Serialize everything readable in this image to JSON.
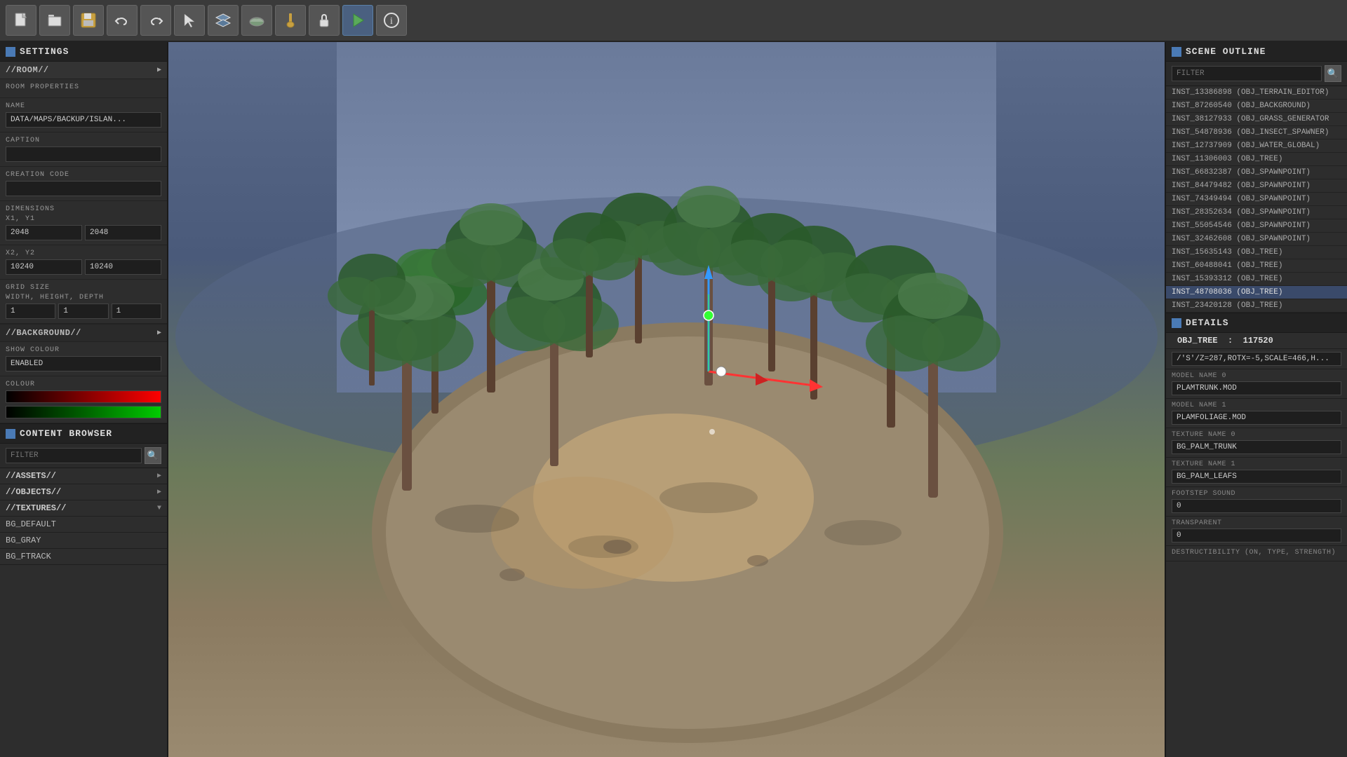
{
  "toolbar": {
    "title": "SETTINGS",
    "tools": [
      {
        "id": "new",
        "icon": "📄",
        "label": "new-file"
      },
      {
        "id": "open",
        "icon": "🗂",
        "label": "open-file"
      },
      {
        "id": "save",
        "icon": "📁",
        "label": "save-file"
      },
      {
        "id": "undo5",
        "icon": "↺",
        "label": "undo"
      },
      {
        "id": "redo",
        "icon": "↻",
        "label": "redo"
      },
      {
        "id": "select",
        "icon": "🖱",
        "label": "select"
      },
      {
        "id": "layer",
        "icon": "⬡",
        "label": "layer"
      },
      {
        "id": "terrain",
        "icon": "⛰",
        "label": "terrain"
      },
      {
        "id": "paint",
        "icon": "🖌",
        "label": "paint"
      },
      {
        "id": "lock",
        "icon": "🔒",
        "label": "lock"
      },
      {
        "id": "play",
        "icon": "▶",
        "label": "play"
      },
      {
        "id": "info",
        "icon": "ℹ",
        "label": "info"
      }
    ]
  },
  "left_panel": {
    "title": "SETTINGS",
    "room_section": {
      "label": "//ROOM//",
      "subsection_label": "ROOM PROPERTIES",
      "name_label": "NAME",
      "name_value": "DATA/MAPS/BACKUP/ISLAN...",
      "caption_label": "CAPTION",
      "caption_value": "",
      "creation_code_label": "CREATION CODE",
      "creation_code_value": "",
      "dimensions_label": "DIMENSIONS",
      "x1y1_label": "X1, Y1",
      "x1_value": "2048",
      "y1_value": "2048",
      "x2y2_label": "X2, Y2",
      "x2_value": "10240",
      "y2_value": "10240",
      "grid_size_label": "GRID SIZE",
      "whd_label": "WIDTH, HEIGHT, DEPTH",
      "width_value": "1",
      "height_value": "1",
      "depth_value": "1"
    },
    "background_section": {
      "label": "//BACKGROUND//",
      "show_colour_label": "SHOW COLOUR",
      "show_colour_value": "ENABLED",
      "colour_label": "COLOUR"
    },
    "content_browser": {
      "title": "CONTENT BROWSER",
      "filter_placeholder": "FILTER",
      "items": [
        {
          "label": "//ASSETS//",
          "has_arrow": true,
          "arrow_direction": "right"
        },
        {
          "label": "//OBJECTS//",
          "has_arrow": true,
          "arrow_direction": "right"
        },
        {
          "label": "//TEXTURES//",
          "has_arrow": true,
          "arrow_direction": "down"
        },
        {
          "label": "BG_DEFAULT",
          "has_arrow": false
        },
        {
          "label": "BG_GRAY",
          "has_arrow": false
        },
        {
          "label": "BG_FTRACK",
          "has_arrow": false
        }
      ]
    }
  },
  "scene_outline": {
    "title": "SCENE OUTLINE",
    "filter_placeholder": "FILTER",
    "items": [
      {
        "id": "inst_13386898",
        "label": "INST_13386898 (OBJ_TERRAIN_EDITOR)"
      },
      {
        "id": "inst_87260540",
        "label": "INST_87260540 (OBJ_BACKGROUND)"
      },
      {
        "id": "inst_38127933",
        "label": "INST_38127933 (OBJ_GRASS_GENERATOR"
      },
      {
        "id": "inst_54878936",
        "label": "INST_54878936 (OBJ_INSECT_SPAWNER)"
      },
      {
        "id": "inst_12737909",
        "label": "INST_12737909 (OBJ_WATER_GLOBAL)"
      },
      {
        "id": "inst_11306003",
        "label": "INST_11306003 (OBJ_TREE)"
      },
      {
        "id": "inst_66832387",
        "label": "INST_66832387 (OBJ_SPAWNPOINT)"
      },
      {
        "id": "inst_84479482",
        "label": "INST_84479482 (OBJ_SPAWNPOINT)"
      },
      {
        "id": "inst_74349494",
        "label": "INST_74349494 (OBJ_SPAWNPOINT)"
      },
      {
        "id": "inst_28352634",
        "label": "INST_28352634 (OBJ_SPAWNPOINT)"
      },
      {
        "id": "inst_55054546",
        "label": "INST_55054546 (OBJ_SPAWNPOINT)"
      },
      {
        "id": "inst_32462608",
        "label": "INST_32462608 (OBJ_SPAWNPOINT)"
      },
      {
        "id": "inst_15635143",
        "label": "INST_15635143 (OBJ_TREE)"
      },
      {
        "id": "inst_60488041",
        "label": "INST_60488041 (OBJ_TREE)"
      },
      {
        "id": "inst_15393312",
        "label": "INST_15393312 (OBJ_TREE)"
      },
      {
        "id": "inst_48708036",
        "label": "INST_48708036 (OBJ_TREE)",
        "selected": true
      },
      {
        "id": "inst_23420128",
        "label": "INST_23420128 (OBJ_TREE)"
      }
    ]
  },
  "details": {
    "title": "DETAILS",
    "obj_label": "OBJ_TREE",
    "obj_id": "117520",
    "creation_code": "/'S'/Z=287,ROTX=-5,SCALE=466,H...",
    "model_name_0_label": "MODEL NAME  0",
    "model_name_0_value": "PLAMTRUNK.MOD",
    "model_name_1_label": "MODEL NAME  1",
    "model_name_1_value": "PLAMFOLIAGE.MOD",
    "texture_name_0_label": "TEXTURE NAME  0",
    "texture_name_0_value": "BG_PALM_TRUNK",
    "texture_name_1_label": "TEXTURE NAME  1",
    "texture_name_1_value": "BG_PALM_LEAFS",
    "footstep_sound_label": "FOOTSTEP SOUND",
    "footstep_sound_value": "0",
    "transparent_label": "TRANSPARENT",
    "transparent_value": "0",
    "destructibility_label": "DESTRUCTIBILITY (ON, TYPE, STRENGTH)"
  },
  "colors": {
    "accent_blue": "#4a7ab5",
    "panel_bg": "#2d2d2d",
    "header_bg": "#222222",
    "input_bg": "#1e1e1e",
    "border": "#444444"
  }
}
